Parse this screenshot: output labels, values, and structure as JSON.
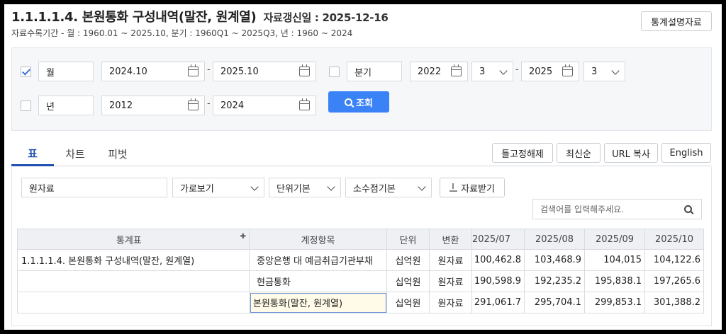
{
  "header": {
    "title": "1.1.1.1.4. 본원통화 구성내역(말잔, 원계열)",
    "updated": "자료갱신일 : 2025-12-16",
    "range": "자료수록기간 - 월 : 1960.01 ~ 2025.10, 분기 : 1960Q1 ~ 2025Q3, 년 : 1960 ~ 2024",
    "desc_button": "통계설명자료"
  },
  "search": {
    "monthly": {
      "checked": true,
      "label": "월",
      "from": "2024.10",
      "to": "2025.10"
    },
    "quarterly": {
      "checked": false,
      "label": "분기",
      "from_year": "2022",
      "from_q": "3",
      "to_year": "2025",
      "to_q": "3"
    },
    "yearly": {
      "checked": false,
      "label": "년",
      "from": "2012",
      "to": "2024"
    },
    "query_button": "조회",
    "dash": "-"
  },
  "tabs": [
    {
      "label": "표",
      "active": true
    },
    {
      "label": "차트",
      "active": false
    },
    {
      "label": "피벗",
      "active": false
    }
  ],
  "actions": {
    "unfreeze": "틀고정해제",
    "latest": "최신순",
    "url_copy": "URL 복사",
    "english": "English"
  },
  "toolbar": {
    "data_type": "원자료",
    "view": "가로보기",
    "unit": "단위기본",
    "decimal": "소수점기본",
    "download": "자료받기",
    "search_placeholder": "검색어를 입력해주세요."
  },
  "table": {
    "headers": [
      "통계표",
      "계정항목",
      "단위",
      "변환",
      "2025/07",
      "2025/08",
      "2025/09",
      "2025/10"
    ],
    "rows": [
      [
        "1.1.1.1.4. 본원통화 구성내역(말잔, 원계열)",
        "중앙은행 대 예금취급기관부채",
        "십억원",
        "원자료",
        "100,462.8",
        "103,468.9",
        "104,015",
        "104,122.6"
      ],
      [
        "",
        "현금통화",
        "십억원",
        "원자료",
        "190,598.9",
        "192,235.2",
        "195,838.1",
        "197,265.6"
      ],
      [
        "",
        "본원통화(말잔, 원계열)",
        "십억원",
        "원자료",
        "291,061.7",
        "295,704.1",
        "299,853.1",
        "301,388.2"
      ]
    ]
  },
  "colors": {
    "accent": "#3b82f6",
    "tab_active": "#1f4fb0",
    "header_bg": "#eef0f3"
  }
}
